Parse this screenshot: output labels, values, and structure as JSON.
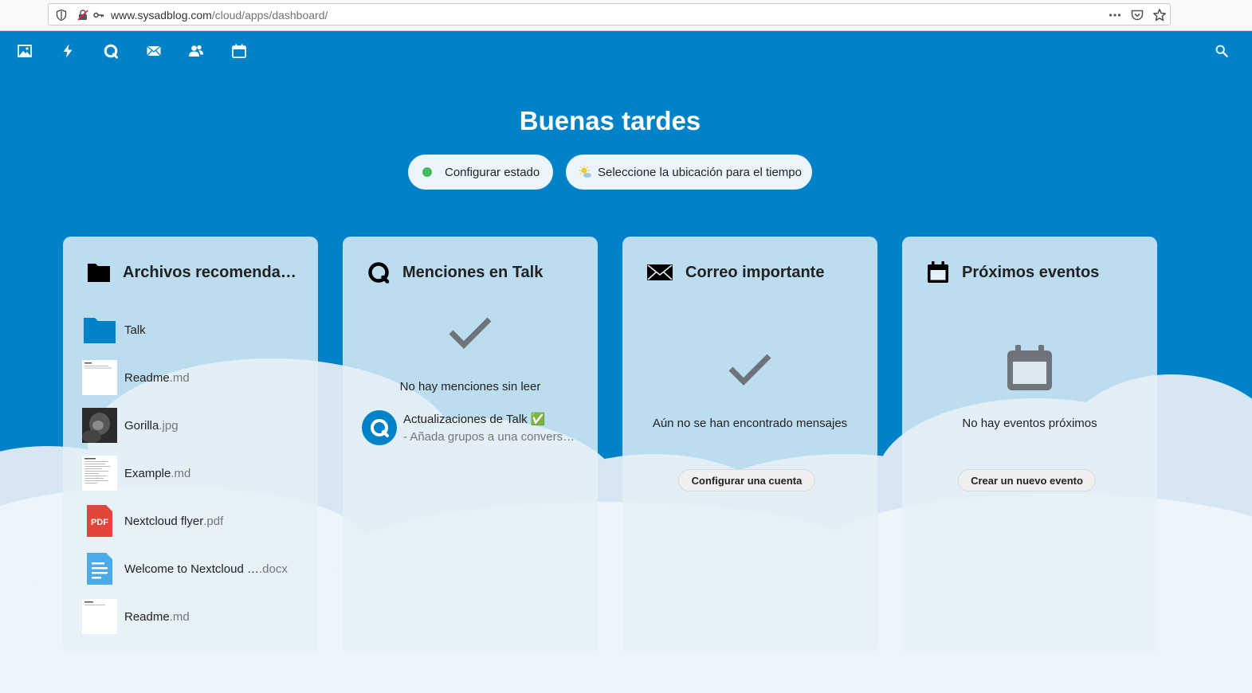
{
  "browser": {
    "url_host": "www.sysadblog.com",
    "url_path": "/cloud/apps/dashboard/"
  },
  "header": {
    "apps": [
      "photos-icon",
      "activity-icon",
      "talk-icon",
      "mail-icon",
      "contacts-icon",
      "calendar-icon"
    ],
    "search_icon": "search-icon"
  },
  "greeting": "Buenas tardes",
  "status_button": {
    "label": "Configurar estado",
    "dot_color": "#46ba61"
  },
  "weather_button": {
    "label": "Seleccione la ubicación para el tiempo"
  },
  "panels": {
    "files": {
      "title": "Archivos recomenda…",
      "items": [
        {
          "name": "Talk",
          "ext": "",
          "type": "folder"
        },
        {
          "name": "Readme",
          "ext": ".md",
          "type": "doc-preview"
        },
        {
          "name": "Gorilla",
          "ext": ".jpg",
          "type": "image"
        },
        {
          "name": "Example",
          "ext": ".md",
          "type": "doc-preview"
        },
        {
          "name": "Nextcloud flyer",
          "ext": ".pdf",
          "type": "pdf",
          "badge": "PDF"
        },
        {
          "name": "Welcome to Nextcloud …",
          "ext": ".docx",
          "type": "docx"
        },
        {
          "name": "Readme",
          "ext": ".md",
          "type": "doc-preview"
        }
      ]
    },
    "talk": {
      "title": "Menciones en Talk",
      "empty_text": "No hay menciones sin leer",
      "mention": {
        "title": "Actualizaciones de Talk ✅",
        "subtitle": "- Añada grupos a una convers…"
      }
    },
    "mail": {
      "title": "Correo importante",
      "empty_text": "Aún no se han encontrado mensajes",
      "button": "Configurar una cuenta"
    },
    "events": {
      "title": "Próximos eventos",
      "empty_text": "No hay eventos próximos",
      "button": "Crear un nuevo evento"
    }
  },
  "colors": {
    "primary": "#0082c9",
    "pdf_red": "#e2453c",
    "docx_blue": "#49abe9"
  }
}
